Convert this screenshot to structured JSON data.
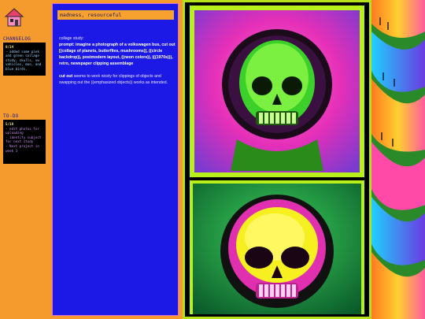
{
  "sidebar": {
    "home_icon": "house-icon",
    "changelog_heading": "CHANGELOG",
    "changelog": [
      {
        "date": "8/14",
        "text": "- added some pink and green collage study, skulls, vw vehicles, moo, and blue birds."
      }
    ],
    "todo_heading": "TO-DO",
    "todo": [
      {
        "date": "5/18",
        "text": "- edit photos for uploading\n- identify subject for next study\n- Next project in week 3"
      }
    ]
  },
  "post": {
    "title": "madness, resourceful",
    "label": "collage study:",
    "prompt": "prompt: imagine a photograph of a volkswagen bus, cut out [(collage of planets, butterflies, mushrooms)], ((circle backdrop)), postmodern layout, ((neon colors)), (((1970s))), retro, newspaper clipping assemblage",
    "note_emphasis": "cut out",
    "note_rest": " seems to work nicely for clippings of objects and swapping out the ((emphasized objects)) works as intended."
  },
  "colors": {
    "orange": "#f59a2c",
    "blue": "#1c18e6",
    "lime": "#b7e21a",
    "magenta": "#e040d0"
  }
}
